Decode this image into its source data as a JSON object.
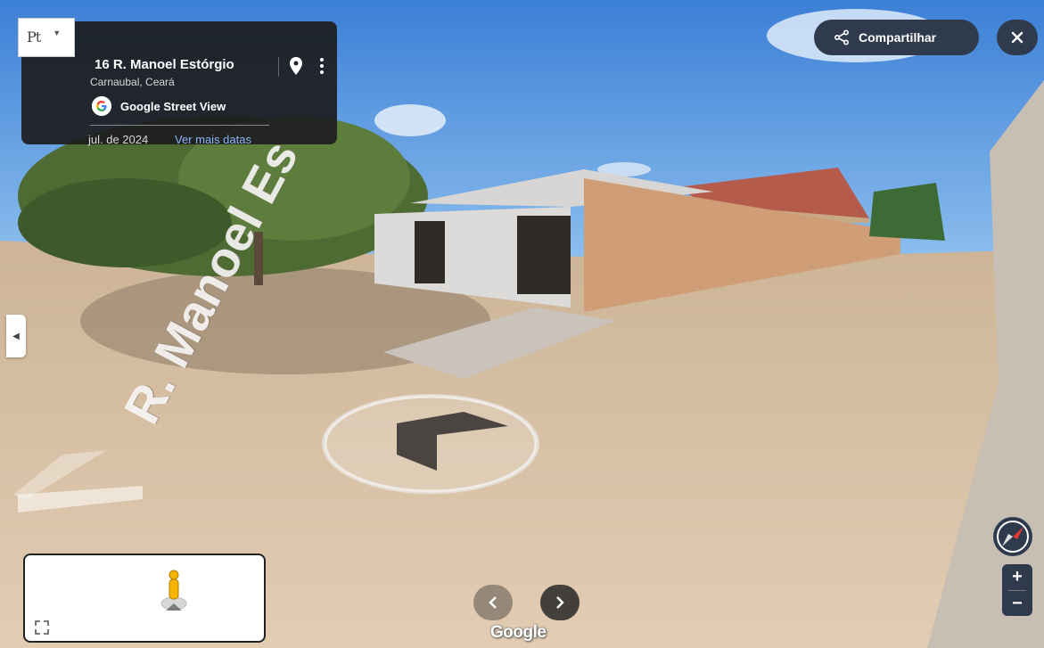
{
  "info_card": {
    "image_type_label": "Pt",
    "address": "16 R. Manoel Estórgio",
    "locality": "Carnaubal, Ceará",
    "source_label": "Google Street View",
    "date": "jul. de 2024",
    "more_dates_link": "Ver mais datas"
  },
  "share_button": {
    "label": "Compartilhar",
    "icon": "share-icon"
  },
  "close_button": {
    "icon": "close-icon"
  },
  "street_overlay_label": "R. Manoel Es",
  "nav": {
    "prev_icon": "chevron-left-icon",
    "next_icon": "chevron-right-icon"
  },
  "watermark": "Google",
  "zoom": {
    "in_label": "+",
    "out_label": "−"
  },
  "colors": {
    "panel_dark": "#1c1c1e",
    "button_navy": "#2f3a4d",
    "link_blue": "#8ab4f8",
    "sky": "#4a8ee0",
    "ground": "#d9c3a8"
  }
}
